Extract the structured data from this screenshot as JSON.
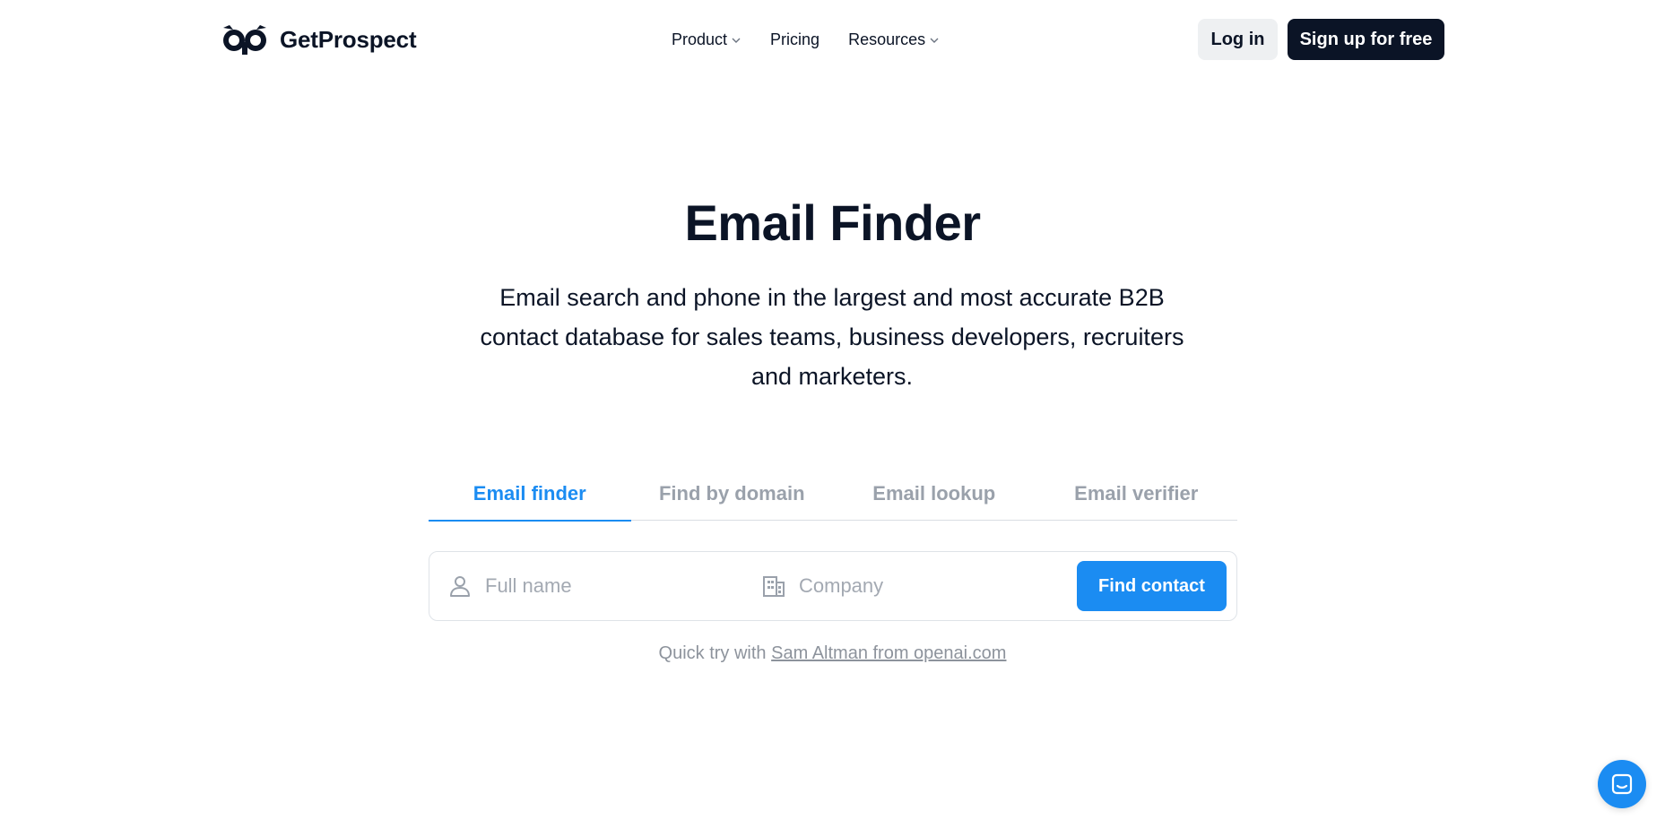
{
  "header": {
    "brand": "GetProspect",
    "nav": [
      {
        "label": "Product",
        "has_dropdown": true
      },
      {
        "label": "Pricing",
        "has_dropdown": false
      },
      {
        "label": "Resources",
        "has_dropdown": true
      }
    ],
    "login_label": "Log in",
    "signup_label": "Sign up for free"
  },
  "hero": {
    "title": "Email Finder",
    "subtitle": "Email search and phone in the largest and most accurate B2B contact database for sales teams, business developers, recruiters and marketers."
  },
  "tabs": [
    {
      "label": "Email finder",
      "active": true
    },
    {
      "label": "Find by domain",
      "active": false
    },
    {
      "label": "Email lookup",
      "active": false
    },
    {
      "label": "Email verifier",
      "active": false
    }
  ],
  "search": {
    "name_placeholder": "Full name",
    "name_value": "",
    "company_placeholder": "Company",
    "company_value": "",
    "button_label": "Find contact"
  },
  "quick_try": {
    "prefix": "Quick try with",
    "link_label": "Sam Altman from openai.com"
  },
  "icons": {
    "logo": "owl-logo-icon",
    "name_field": "user-icon",
    "company_field": "building-icon",
    "chat": "chat-icon"
  },
  "colors": {
    "accent": "#1b8cf2",
    "dark": "#0b1426",
    "muted": "#9aa1ab"
  }
}
